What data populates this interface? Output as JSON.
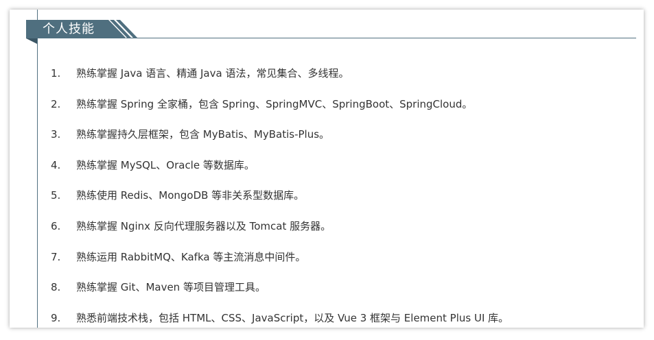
{
  "section": {
    "title": "个人技能"
  },
  "skills": [
    {
      "num": "1.",
      "text": "熟练掌握 Java 语言、精通 Java 语法，常见集合、多线程。"
    },
    {
      "num": "2.",
      "text": "熟练掌握 Spring 全家桶，包含 Spring、SpringMVC、SpringBoot、SpringCloud。"
    },
    {
      "num": "3.",
      "text": "熟练掌握持久层框架，包含 MyBatis、MyBatis-Plus。"
    },
    {
      "num": "4.",
      "text": "熟练掌握 MySQL、Oracle 等数据库。"
    },
    {
      "num": "5.",
      "text": "熟练使用 Redis、MongoDB 等非关系型数据库。"
    },
    {
      "num": "6.",
      "text": "熟练掌握 Nginx 反向代理服务器以及 Tomcat 服务器。"
    },
    {
      "num": "7.",
      "text": "熟练运用 RabbitMQ、Kafka 等主流消息中间件。"
    },
    {
      "num": "8.",
      "text": "熟练掌握 Git、Maven 等项目管理工具。"
    },
    {
      "num": "9.",
      "text": "熟悉前端技术栈，包括 HTML、CSS、JavaScript，以及 Vue 3 框架与 Element Plus UI 库。"
    }
  ],
  "colors": {
    "header_bg": "#4f6f7f",
    "header_dark": "#3b5665",
    "text": "#333333"
  }
}
